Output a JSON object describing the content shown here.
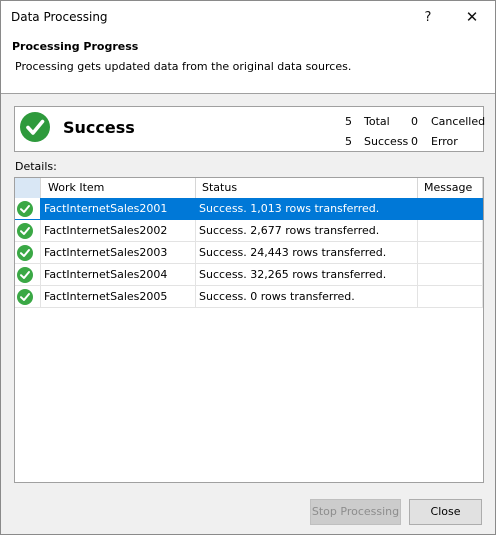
{
  "window": {
    "title": "Data Processing",
    "help_glyph": "?",
    "close_glyph": "✕"
  },
  "header": {
    "title": "Processing Progress",
    "subtitle": "Processing gets updated data from the original data sources."
  },
  "summary": {
    "status": "Success",
    "total_count": "5",
    "total_label": "Total",
    "cancelled_count": "0",
    "cancelled_label": "Cancelled",
    "success_count": "5",
    "success_label": "Success",
    "error_count": "0",
    "error_label": "Error"
  },
  "details": {
    "label": "Details:",
    "columns": [
      "Work Item",
      "Status",
      "Message"
    ],
    "rows": [
      {
        "item": "FactInternetSales2001",
        "status": "Success. 1,013 rows transferred.",
        "message": ""
      },
      {
        "item": "FactInternetSales2002",
        "status": "Success. 2,677 rows transferred.",
        "message": ""
      },
      {
        "item": "FactInternetSales2003",
        "status": "Success. 24,443 rows transferred.",
        "message": ""
      },
      {
        "item": "FactInternetSales2004",
        "status": "Success. 32,265 rows transferred.",
        "message": ""
      },
      {
        "item": "FactInternetSales2005",
        "status": "Success. 0 rows transferred.",
        "message": ""
      }
    ]
  },
  "buttons": {
    "stop": "Stop Processing",
    "close": "Close"
  },
  "colors": {
    "accent": "#0078d7",
    "success": "#2e9a3c"
  }
}
